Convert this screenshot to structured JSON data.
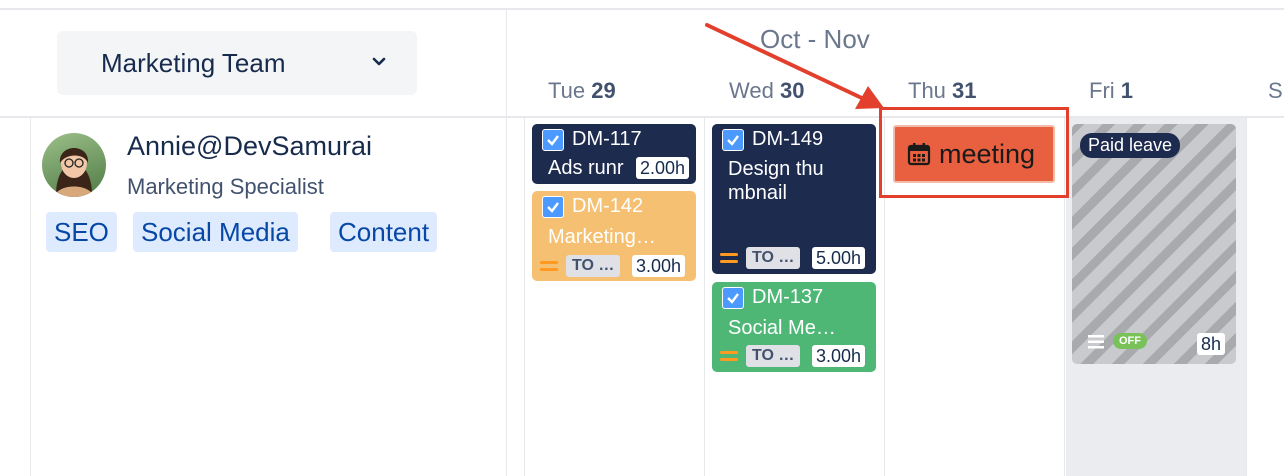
{
  "team_select": {
    "label": "Marketing Team"
  },
  "calendar": {
    "month": "Oct - Nov",
    "days": [
      {
        "dow": "Tue",
        "num": "29"
      },
      {
        "dow": "Wed",
        "num": "30"
      },
      {
        "dow": "Thu",
        "num": "31"
      },
      {
        "dow": "Fri",
        "num": "1"
      },
      {
        "dow": "S",
        "num": ""
      }
    ]
  },
  "user": {
    "name": "Annie@DevSamurai",
    "role": "Marketing Specialist",
    "tags": [
      "SEO",
      "Social Media",
      "Content"
    ]
  },
  "tasks": [
    {
      "key": "DM-117",
      "title": "Ads runr",
      "hours": "2.00h",
      "color": "#1d2b4f"
    },
    {
      "key": "DM-142",
      "title": "Marketing…",
      "status": "TO …",
      "hours": "3.00h",
      "color": "#f5c072"
    },
    {
      "key": "DM-149",
      "title": "Design thu mbnail",
      "status": "TO …",
      "hours": "5.00h",
      "color": "#1d2b4f"
    },
    {
      "key": "DM-137",
      "title": "Social Me…",
      "status": "TO …",
      "hours": "3.00h",
      "color": "#4fb776"
    }
  ],
  "meeting": {
    "label": "meeting",
    "icon": "calendar-icon",
    "color": "#e8603f"
  },
  "leave": {
    "label": "Paid leave",
    "badge": "OFF",
    "hours": "8h"
  },
  "annotation": {
    "arrow_color": "#e2402d"
  }
}
